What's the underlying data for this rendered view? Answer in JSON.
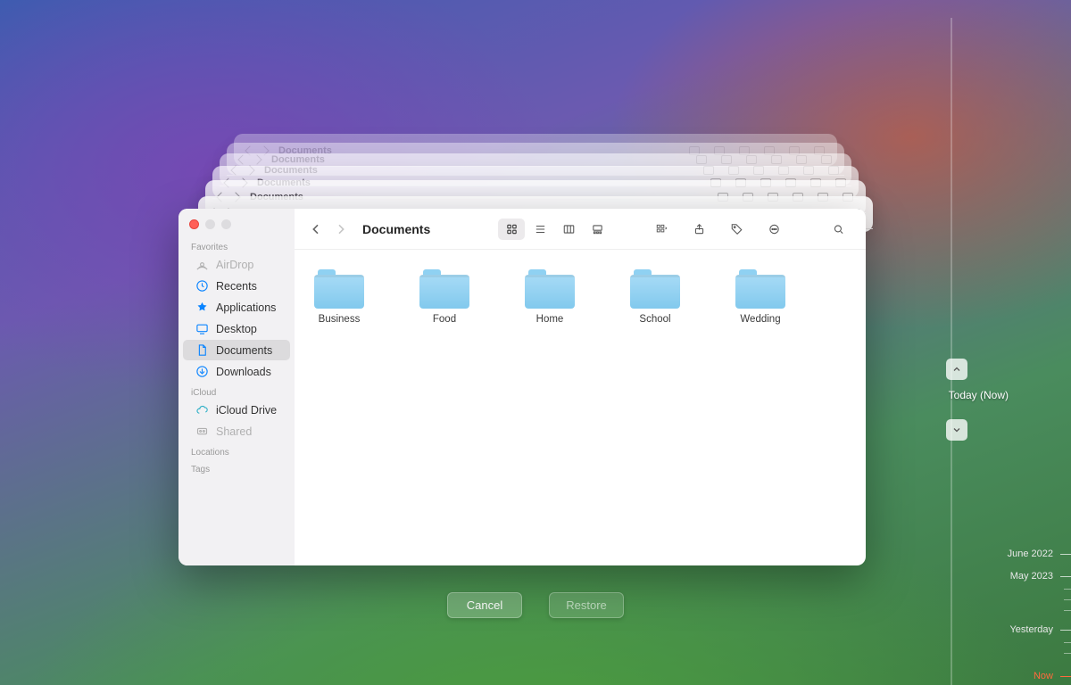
{
  "window_title": "Documents",
  "sidebar": {
    "sections": {
      "favorites": "Favorites",
      "icloud": "iCloud",
      "locations": "Locations",
      "tags": "Tags"
    },
    "items": {
      "airdrop": "AirDrop",
      "recents": "Recents",
      "applications": "Applications",
      "desktop": "Desktop",
      "documents": "Documents",
      "downloads": "Downloads",
      "iclouddrive": "iCloud Drive",
      "shared": "Shared"
    }
  },
  "folders": [
    "Business",
    "Food",
    "Home",
    "School",
    "Wedding"
  ],
  "buttons": {
    "cancel": "Cancel",
    "restore": "Restore"
  },
  "timeline": {
    "now": "Today (Now)",
    "ticks": [
      "June 2022",
      "May 2023",
      "Yesterday",
      "Now"
    ]
  },
  "stacked_title": "Documents"
}
